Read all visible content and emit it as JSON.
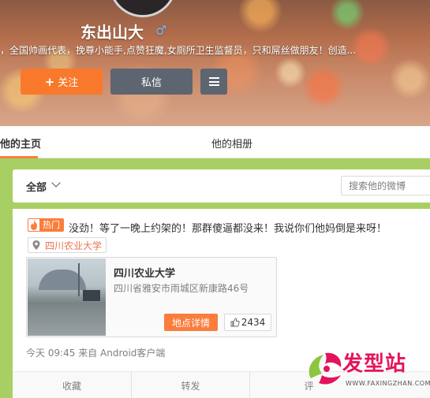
{
  "profile": {
    "username": "东出山大",
    "gender_symbol": "♂",
    "bio": "，全国帅画代表，挽尊小能手,点赞狂魔,女厕所卫生监督员，只和屌丝做朋友！创造..."
  },
  "actions": {
    "follow_icon": "+",
    "follow_label": "关注",
    "message_label": "私信"
  },
  "tabs": {
    "home": "他的主页",
    "album": "他的相册"
  },
  "filter": {
    "all_label": "全部",
    "search_placeholder": "搜索他的微博"
  },
  "post": {
    "hot_label": "热门",
    "text": "没劲！等了一晚上约架的！那群傻逼都没来！我说你们他妈倒是来呀！",
    "location_tag": "四川农业大学",
    "location_card": {
      "name": "四川农业大学",
      "address": "四川省雅安市雨城区新康路46号",
      "detail_button": "地点详情",
      "like_count": "2434"
    },
    "meta": "今天 09:45 来自 Android客户端",
    "bar": {
      "favorite": "收藏",
      "forward": "转发",
      "comment": "评"
    }
  },
  "watermark": {
    "text": "发型站",
    "url": "WWW.FAXINGZHAN.COM"
  },
  "colors": {
    "accent_orange": "#fa7d3c",
    "background_green": "#a8cf63",
    "button_gray": "#5d6570",
    "watermark_pink": "#e4145c"
  }
}
